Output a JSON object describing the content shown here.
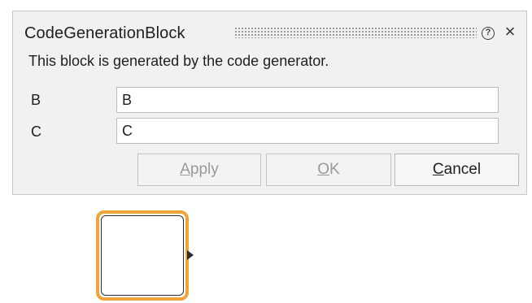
{
  "dialog": {
    "title": "CodeGenerationBlock",
    "help_icon_glyph": "?",
    "close_icon_glyph": "×",
    "description": "This block is generated by the code generator.",
    "fields": [
      {
        "label": "B",
        "value": "B"
      },
      {
        "label": "C",
        "value": "C"
      }
    ],
    "buttons": {
      "apply": {
        "mnemonic": "A",
        "rest": "pply",
        "enabled": false
      },
      "ok": {
        "mnemonic": "O",
        "rest": "K",
        "enabled": false
      },
      "cancel": {
        "mnemonic": "C",
        "rest": "ancel",
        "enabled": true
      }
    }
  },
  "canvas": {
    "block_highlight_color": "#f0a437",
    "block_selected": true
  }
}
